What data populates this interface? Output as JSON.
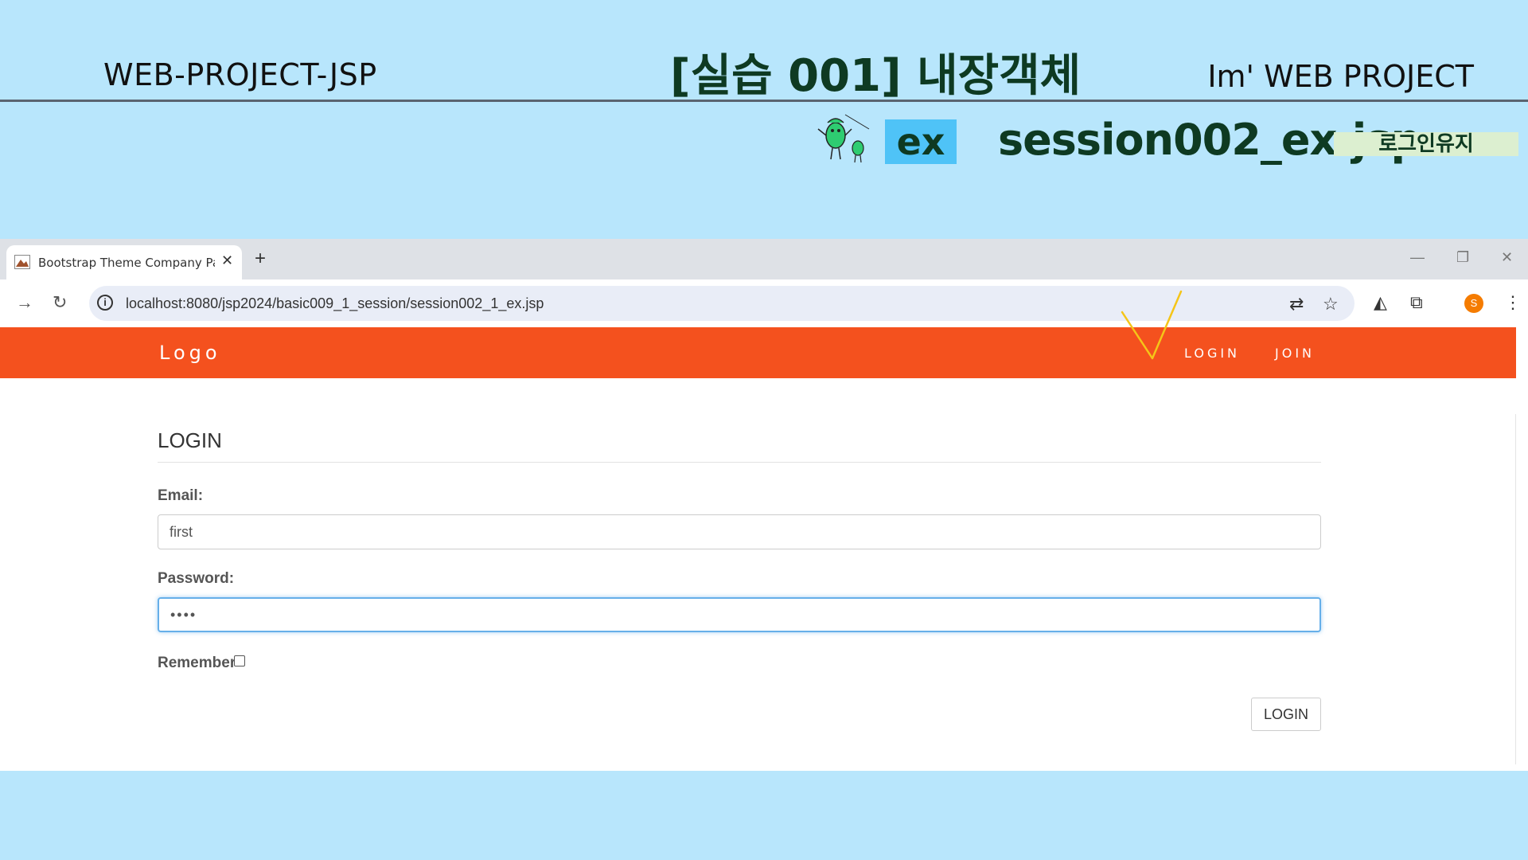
{
  "slide": {
    "left_title": "WEB-PROJECT-JSP",
    "center_title": "[실습 001]  내장객체",
    "right_title": "Im'  WEB PROJECT",
    "ex_badge": "ex",
    "file_title": "session002_ex.jsp",
    "tag": "로그인유지"
  },
  "browser": {
    "tab_title": "Bootstrap Theme Company Pa",
    "tab_close": "✕",
    "new_tab": "+",
    "url": "localhost:8080/jsp2024/basic009_1_session/session002_1_ex.jsp",
    "avatar_letter": "S"
  },
  "site": {
    "logo": "Logo",
    "nav": [
      "LOGIN",
      "JOIN"
    ],
    "accent_color": "#f4511e"
  },
  "form": {
    "title": "LOGIN",
    "email_label": "Email:",
    "email_value": "first",
    "password_label": "Password:",
    "password_value": "••••",
    "remember_label": "Remember",
    "submit_label": "LOGIN"
  }
}
